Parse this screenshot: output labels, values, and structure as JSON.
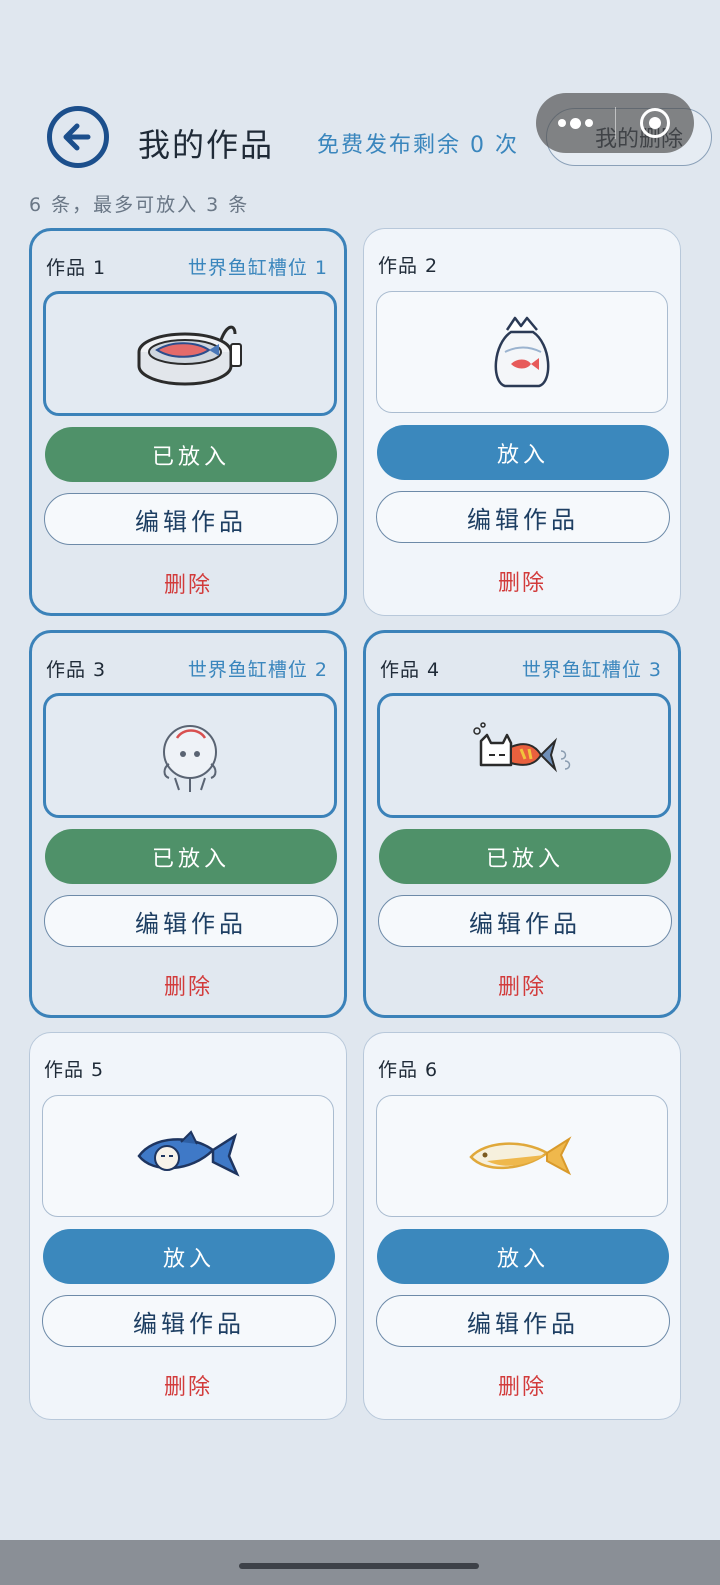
{
  "header": {
    "title": "我的作品",
    "remaining": "免费发布剩余 0 次",
    "my_delete": "我的删除",
    "count": "6 条，最多可放入 3 条"
  },
  "colors": {
    "accent": "#3b88bd",
    "placed": "#4f9169",
    "danger": "#d23b3b",
    "back": "#1c4f8c"
  },
  "works": [
    {
      "title": "作品 1",
      "slot": "世界鱼缸槽位 1",
      "action": "已放入",
      "edit": "编辑作品",
      "delete": "删除",
      "icon": "canned-fish-icon"
    },
    {
      "title": "作品 2",
      "slot": "",
      "action": "放入",
      "edit": "编辑作品",
      "delete": "删除",
      "icon": "fish-bag-icon"
    },
    {
      "title": "作品 3",
      "slot": "世界鱼缸槽位 2",
      "action": "已放入",
      "edit": "编辑作品",
      "delete": "删除",
      "icon": "bubble-creature-icon"
    },
    {
      "title": "作品 4",
      "slot": "世界鱼缸槽位 3",
      "action": "已放入",
      "edit": "编辑作品",
      "delete": "删除",
      "icon": "cat-fish-icon"
    },
    {
      "title": "作品 5",
      "slot": "",
      "action": "放入",
      "edit": "编辑作品",
      "delete": "删除",
      "icon": "blue-fish-icon"
    },
    {
      "title": "作品 6",
      "slot": "",
      "action": "放入",
      "edit": "编辑作品",
      "delete": "删除",
      "icon": "yellow-fish-icon"
    }
  ]
}
